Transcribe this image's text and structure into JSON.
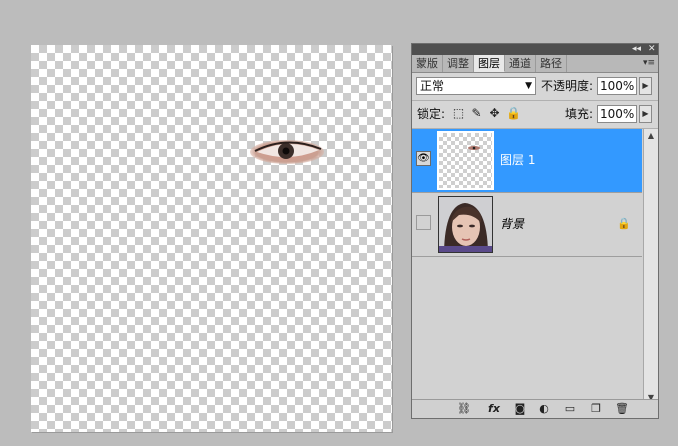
{
  "panel": {
    "title_controls": {
      "collapse": "◂◂",
      "close": "✕"
    },
    "tabs": [
      {
        "label": "蒙版",
        "active": false
      },
      {
        "label": "调整",
        "active": false
      },
      {
        "label": "图层",
        "active": true
      },
      {
        "label": "通道",
        "active": false
      },
      {
        "label": "路径",
        "active": false
      }
    ],
    "menu_icon": "▾≡",
    "blend_mode": "正常",
    "opacity_label": "不透明度:",
    "opacity_value": "100%",
    "lock_label": "锁定:",
    "fill_label": "填充:",
    "fill_value": "100%",
    "layers": [
      {
        "name": "图层 1",
        "selected": true,
        "visible": true
      },
      {
        "name": "背景",
        "selected": false,
        "visible": false,
        "locked": true
      }
    ]
  },
  "icons": {
    "eye": "eye-icon",
    "lock": "lock-icon",
    "link": "link-icon",
    "fx": "fx-icon"
  },
  "colors": {
    "selection": "#3399ff",
    "panel_bg": "#d6d6d6",
    "workspace_bg": "#bcbcbc"
  }
}
